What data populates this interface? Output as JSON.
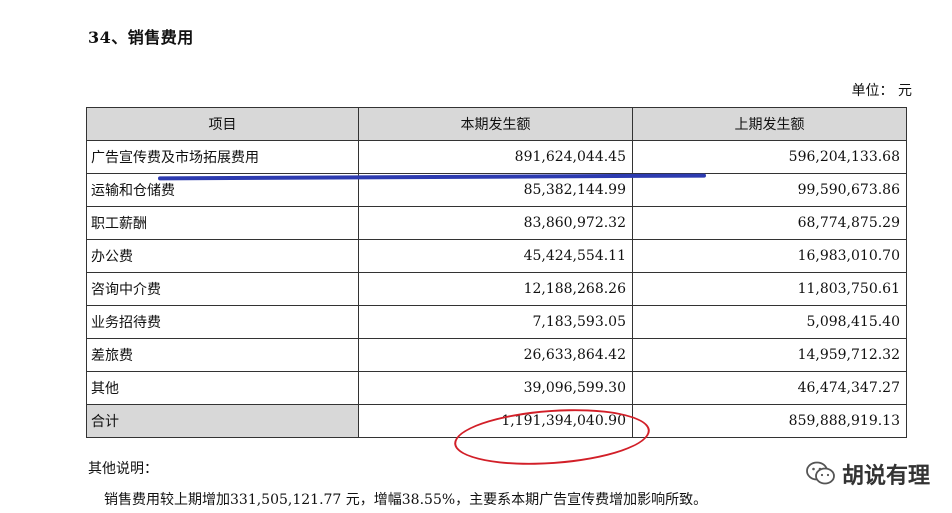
{
  "section_title": "34、销售费用",
  "unit_text": "单位：  元",
  "table": {
    "headers": [
      "项目",
      "本期发生额",
      "上期发生额"
    ],
    "rows": [
      {
        "item": "广告宣传费及市场拓展费用",
        "current": "891,624,044.45",
        "previous": "596,204,133.68"
      },
      {
        "item": "运输和仓储费",
        "current": "85,382,144.99",
        "previous": "99,590,673.86"
      },
      {
        "item": "职工薪酬",
        "current": "83,860,972.32",
        "previous": "68,774,875.29"
      },
      {
        "item": "办公费",
        "current": "45,424,554.11",
        "previous": "16,983,010.70"
      },
      {
        "item": "咨询中介费",
        "current": "12,188,268.26",
        "previous": "11,803,750.61"
      },
      {
        "item": "业务招待费",
        "current": "7,183,593.05",
        "previous": "5,098,415.40"
      },
      {
        "item": "差旅费",
        "current": "26,633,864.42",
        "previous": "14,959,712.32"
      },
      {
        "item": "其他",
        "current": "39,096,599.30",
        "previous": "46,474,347.27"
      }
    ],
    "total": {
      "item": "合计",
      "current": "1,191,394,040.90",
      "previous": "859,888,919.13"
    }
  },
  "note_title": "其他说明：",
  "note_text": "销售费用较上期增加331,505,121.77 元，增幅38.55%，主要系本期广告宣传费增加影响所致。",
  "watermark": {
    "icon": "wechat-icon",
    "text": "胡说有理"
  },
  "colors": {
    "header_bg": "#d8d8d8",
    "highlight_underline": "#2d3bb0",
    "highlight_circle": "#d21f28"
  }
}
